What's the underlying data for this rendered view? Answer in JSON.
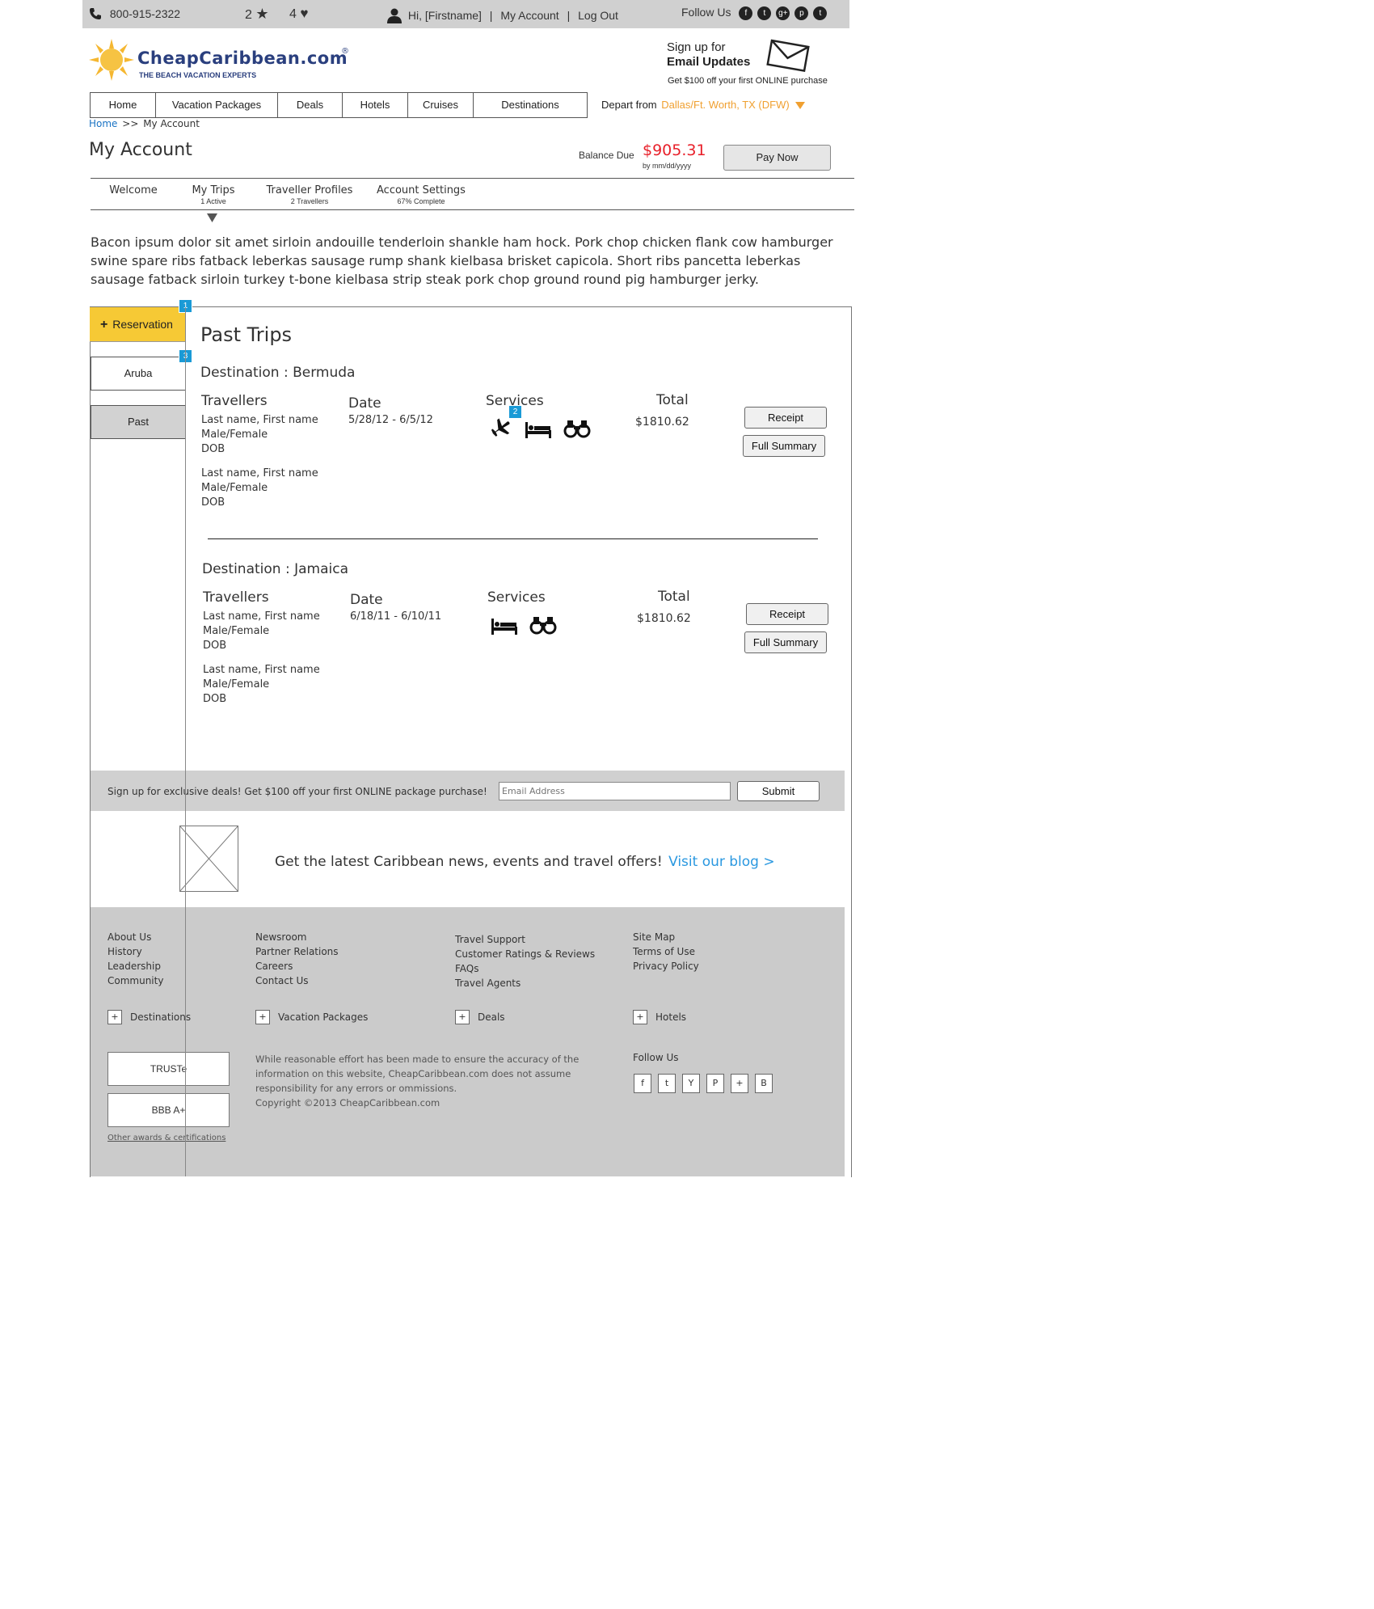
{
  "topbar": {
    "phone": "800-915-2322",
    "star_count": "2",
    "heart_count": "4",
    "greeting": "Hi, [Firstname]",
    "sep1": "|",
    "my_account": "My Account",
    "sep2": "|",
    "logout": "Log Out",
    "follow_us": "Follow Us",
    "social": [
      "f",
      "t",
      "g+",
      "p",
      "t"
    ]
  },
  "logo": {
    "name": "CheapCaribbean.com",
    "tagline": "THE BEACH VACATION EXPERTS"
  },
  "email_signup": {
    "line1": "Sign up for",
    "line2": "Email Updates",
    "line3": "Get $100 off your first ONLINE purchase"
  },
  "nav": {
    "items": [
      "Home",
      "Vacation Packages",
      "Deals",
      "Hotels",
      "Cruises",
      "Destinations"
    ],
    "depart_label": "Depart from",
    "depart_value": "Dallas/Ft. Worth, TX (DFW)"
  },
  "breadcrumb": {
    "home": "Home",
    "separator": ">>",
    "current": "My Account"
  },
  "page_title": "My Account",
  "balance": {
    "label": "Balance Due",
    "amount": "$905.31",
    "due": "by mm/dd/yyyy",
    "pay_button": "Pay Now"
  },
  "tabs": [
    {
      "label": "Welcome",
      "sub": ""
    },
    {
      "label": "My Trips",
      "sub": "1 Active"
    },
    {
      "label": "Traveller Profiles",
      "sub": "2 Travellers"
    },
    {
      "label": "Account Settings",
      "sub": "67% Complete"
    }
  ],
  "intro": "Bacon ipsum dolor sit amet sirloin andouille tenderloin shankle ham hock. Pork chop chicken flank cow hamburger swine spare ribs fatback leberkas sausage rump shank kielbasa brisket capicola. Short ribs pancetta leberkas sausage fatback sirloin turkey t-bone kielbasa strip steak pork chop ground round pig hamburger jerky.",
  "sidebar": {
    "reservation": "Reservation",
    "plus": "+",
    "items": [
      "Aruba",
      "Past"
    ],
    "badges": [
      "1",
      "3"
    ]
  },
  "past_trips": {
    "title": "Past Trips",
    "headers": {
      "travellers": "Travellers",
      "date": "Date",
      "services": "Services",
      "total": "Total"
    },
    "service_badge": "2",
    "trips": [
      {
        "destination": "Destination : Bermuda",
        "travellers": [
          {
            "name": "Last name, First name",
            "gender": "Male/Female",
            "dob": "DOB"
          },
          {
            "name": "Last name, First name",
            "gender": "Male/Female",
            "dob": "DOB"
          }
        ],
        "date": "5/28/12 - 6/5/12",
        "services": [
          "plane-icon",
          "bed-icon",
          "binoculars-icon"
        ],
        "total": "$1810.62",
        "receipt": "Receipt",
        "summary": "Full Summary"
      },
      {
        "destination": "Destination : Jamaica",
        "travellers": [
          {
            "name": "Last name, First name",
            "gender": "Male/Female",
            "dob": "DOB"
          },
          {
            "name": "Last name, First name",
            "gender": "Male/Female",
            "dob": "DOB"
          }
        ],
        "date": "6/18/11 - 6/10/11",
        "services": [
          "bed-icon",
          "binoculars-icon"
        ],
        "total": "$1810.62",
        "receipt": "Receipt",
        "summary": "Full Summary"
      }
    ]
  },
  "signup_bar": {
    "text": "Sign up for exclusive deals! Get $100 off your first ONLINE package purchase!",
    "placeholder": "Email Address",
    "submit": "Submit"
  },
  "blog": {
    "text": "Get the latest Caribbean news, events and travel offers!",
    "link": "Visit our blog >"
  },
  "footer": {
    "col1": [
      "About Us",
      "History",
      "Leadership",
      "Community"
    ],
    "col2": [
      "Newsroom",
      "Partner Relations",
      "Careers",
      "Contact Us"
    ],
    "col3": [
      "Travel Support",
      "Customer Ratings & Reviews",
      "FAQs",
      "Travel Agents"
    ],
    "col4": [
      "Site Map",
      "Terms of Use",
      "Privacy Policy"
    ],
    "expanders": [
      "Destinations",
      "Vacation Packages",
      "Deals",
      "Hotels"
    ],
    "expander_symbol": "+",
    "badges": [
      "TRUSTe",
      "BBB A+"
    ],
    "other_awards": "Other awards & certifications",
    "disclaimer": [
      "While reasonable effort has been made to ensure the accuracy of the",
      "information on this website, CheapCaribbean.com does not assume",
      "responsibility for any errors or ommissions.",
      "Copyright ©2013 CheapCaribbean.com"
    ],
    "follow_us": "Follow Us",
    "social": [
      "f",
      "t",
      "Y",
      "P",
      "+",
      "B"
    ]
  }
}
